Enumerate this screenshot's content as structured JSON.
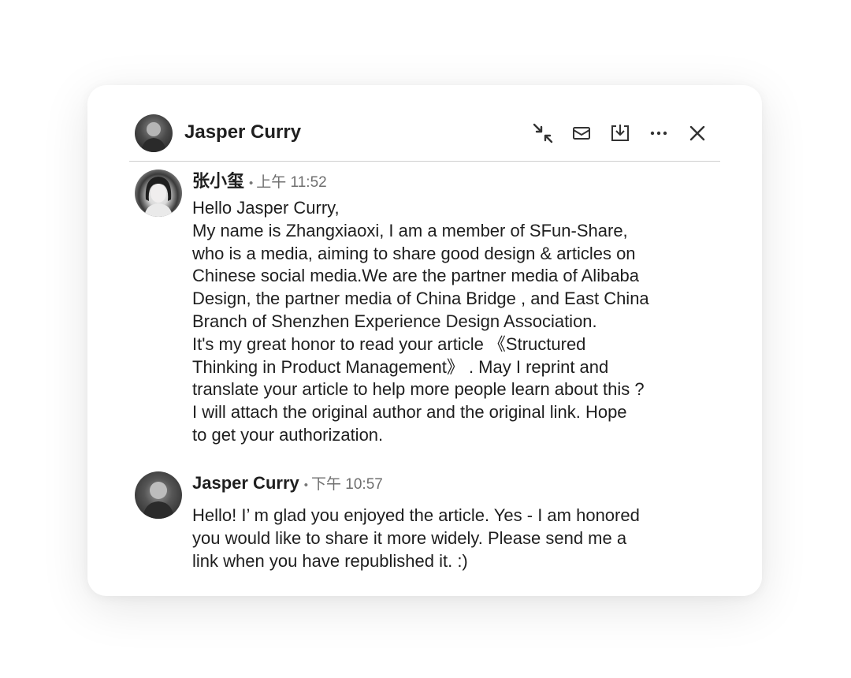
{
  "header": {
    "name": "Jasper Curry",
    "icons": [
      "collapse-arrows-icon",
      "mail-icon",
      "download-icon",
      "more-icon",
      "close-icon"
    ]
  },
  "messages": [
    {
      "sender": "张小玺",
      "separator": "•",
      "time": "上午 11:52",
      "lines": [
        "Hello Jasper Curry,",
        "My name is Zhangxiaoxi, I am a member of SFun-Share,",
        "who is a media, aiming to share good design & articles on",
        "Chinese social media.We are the partner media of Alibaba",
        "Design, the partner media of China Bridge , and East China",
        "Branch of Shenzhen Experience Design Association.",
        "It's my great honor to read your article 《Structured",
        "Thinking in Product Management》 . May I reprint and",
        "translate your article to help more people learn about this ?",
        "I will attach the original author and the original link. Hope",
        "to get your authorization."
      ]
    },
    {
      "sender": "Jasper Curry",
      "separator": "•",
      "time": "下午 10:57",
      "lines": [
        "Hello! I’ m glad you enjoyed the article. Yes - I am honored",
        "you would like to share it more widely. Please send me a",
        "link when you have republished it. :)"
      ]
    }
  ]
}
